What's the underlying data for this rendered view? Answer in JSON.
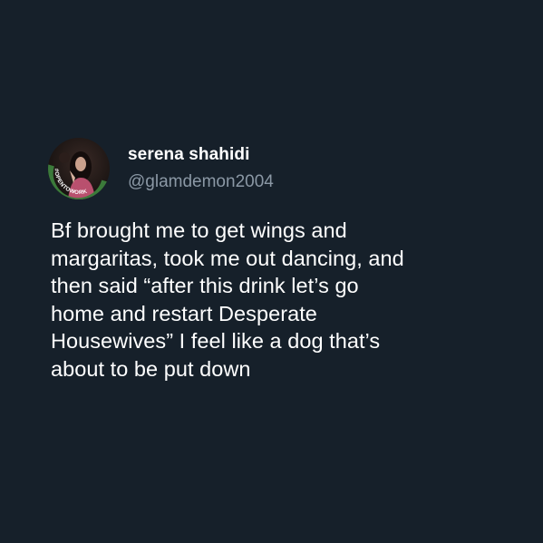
{
  "user": {
    "display_name": "serena shahidi",
    "handle": "@glamdemon2004",
    "avatar_badge_text": "#OPENTOWORK"
  },
  "tweet": {
    "text": "Bf brought me to get wings and\nmargaritas, took me out dancing, and\nthen said “after this drink let’s go\nhome and restart Desperate\nHousewives” I feel like a dog that’s\nabout to be put down"
  },
  "colors": {
    "background": "#16202a",
    "text": "#ffffff",
    "handle": "#8b98a5",
    "badge": "#3b7a3a"
  }
}
